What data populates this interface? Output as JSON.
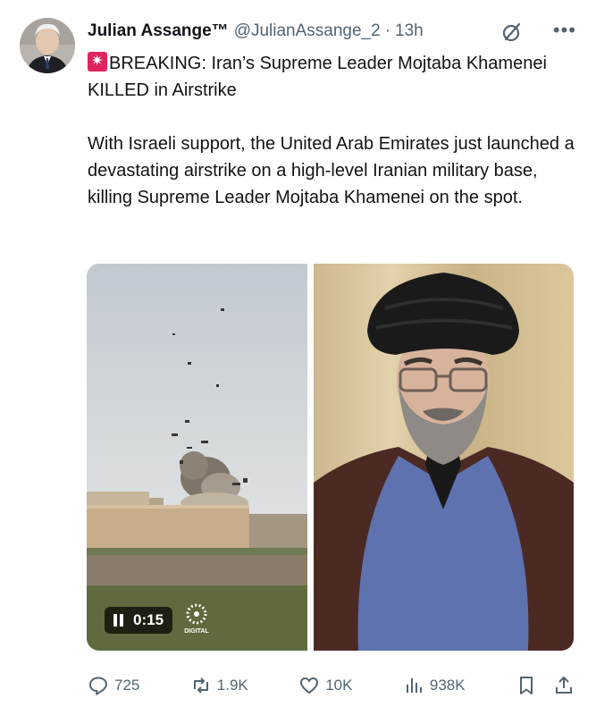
{
  "tweet": {
    "author_name": "Julian Assange™",
    "handle": "@JulianAssange_2",
    "separator": "·",
    "time": "13h",
    "line1": "BREAKING: Iran’s Supreme Leader Mojtaba Khamenei KILLED in Airstrike",
    "line2": "With Israeli support, the United Arab Emirates just launched a devastating airstrike on a high-level Iranian military base, killing Supreme Leader Mojtaba Khamenei on the spot."
  },
  "media": {
    "video_duration": "0:15"
  },
  "stats": {
    "replies": "725",
    "reposts": "1.9K",
    "likes": "10K",
    "views": "938K"
  },
  "icons": {
    "reply": "reply-icon",
    "repost": "repost-icon",
    "like": "like-icon",
    "views": "views-icon",
    "bookmark": "bookmark-icon",
    "share": "share-icon",
    "grok": "grok-icon",
    "more": "more-icon",
    "siren": "siren-emoji-icon"
  },
  "colors": {
    "text_primary": "#0f1419",
    "text_secondary": "#536471",
    "siren": "#e0245e"
  }
}
